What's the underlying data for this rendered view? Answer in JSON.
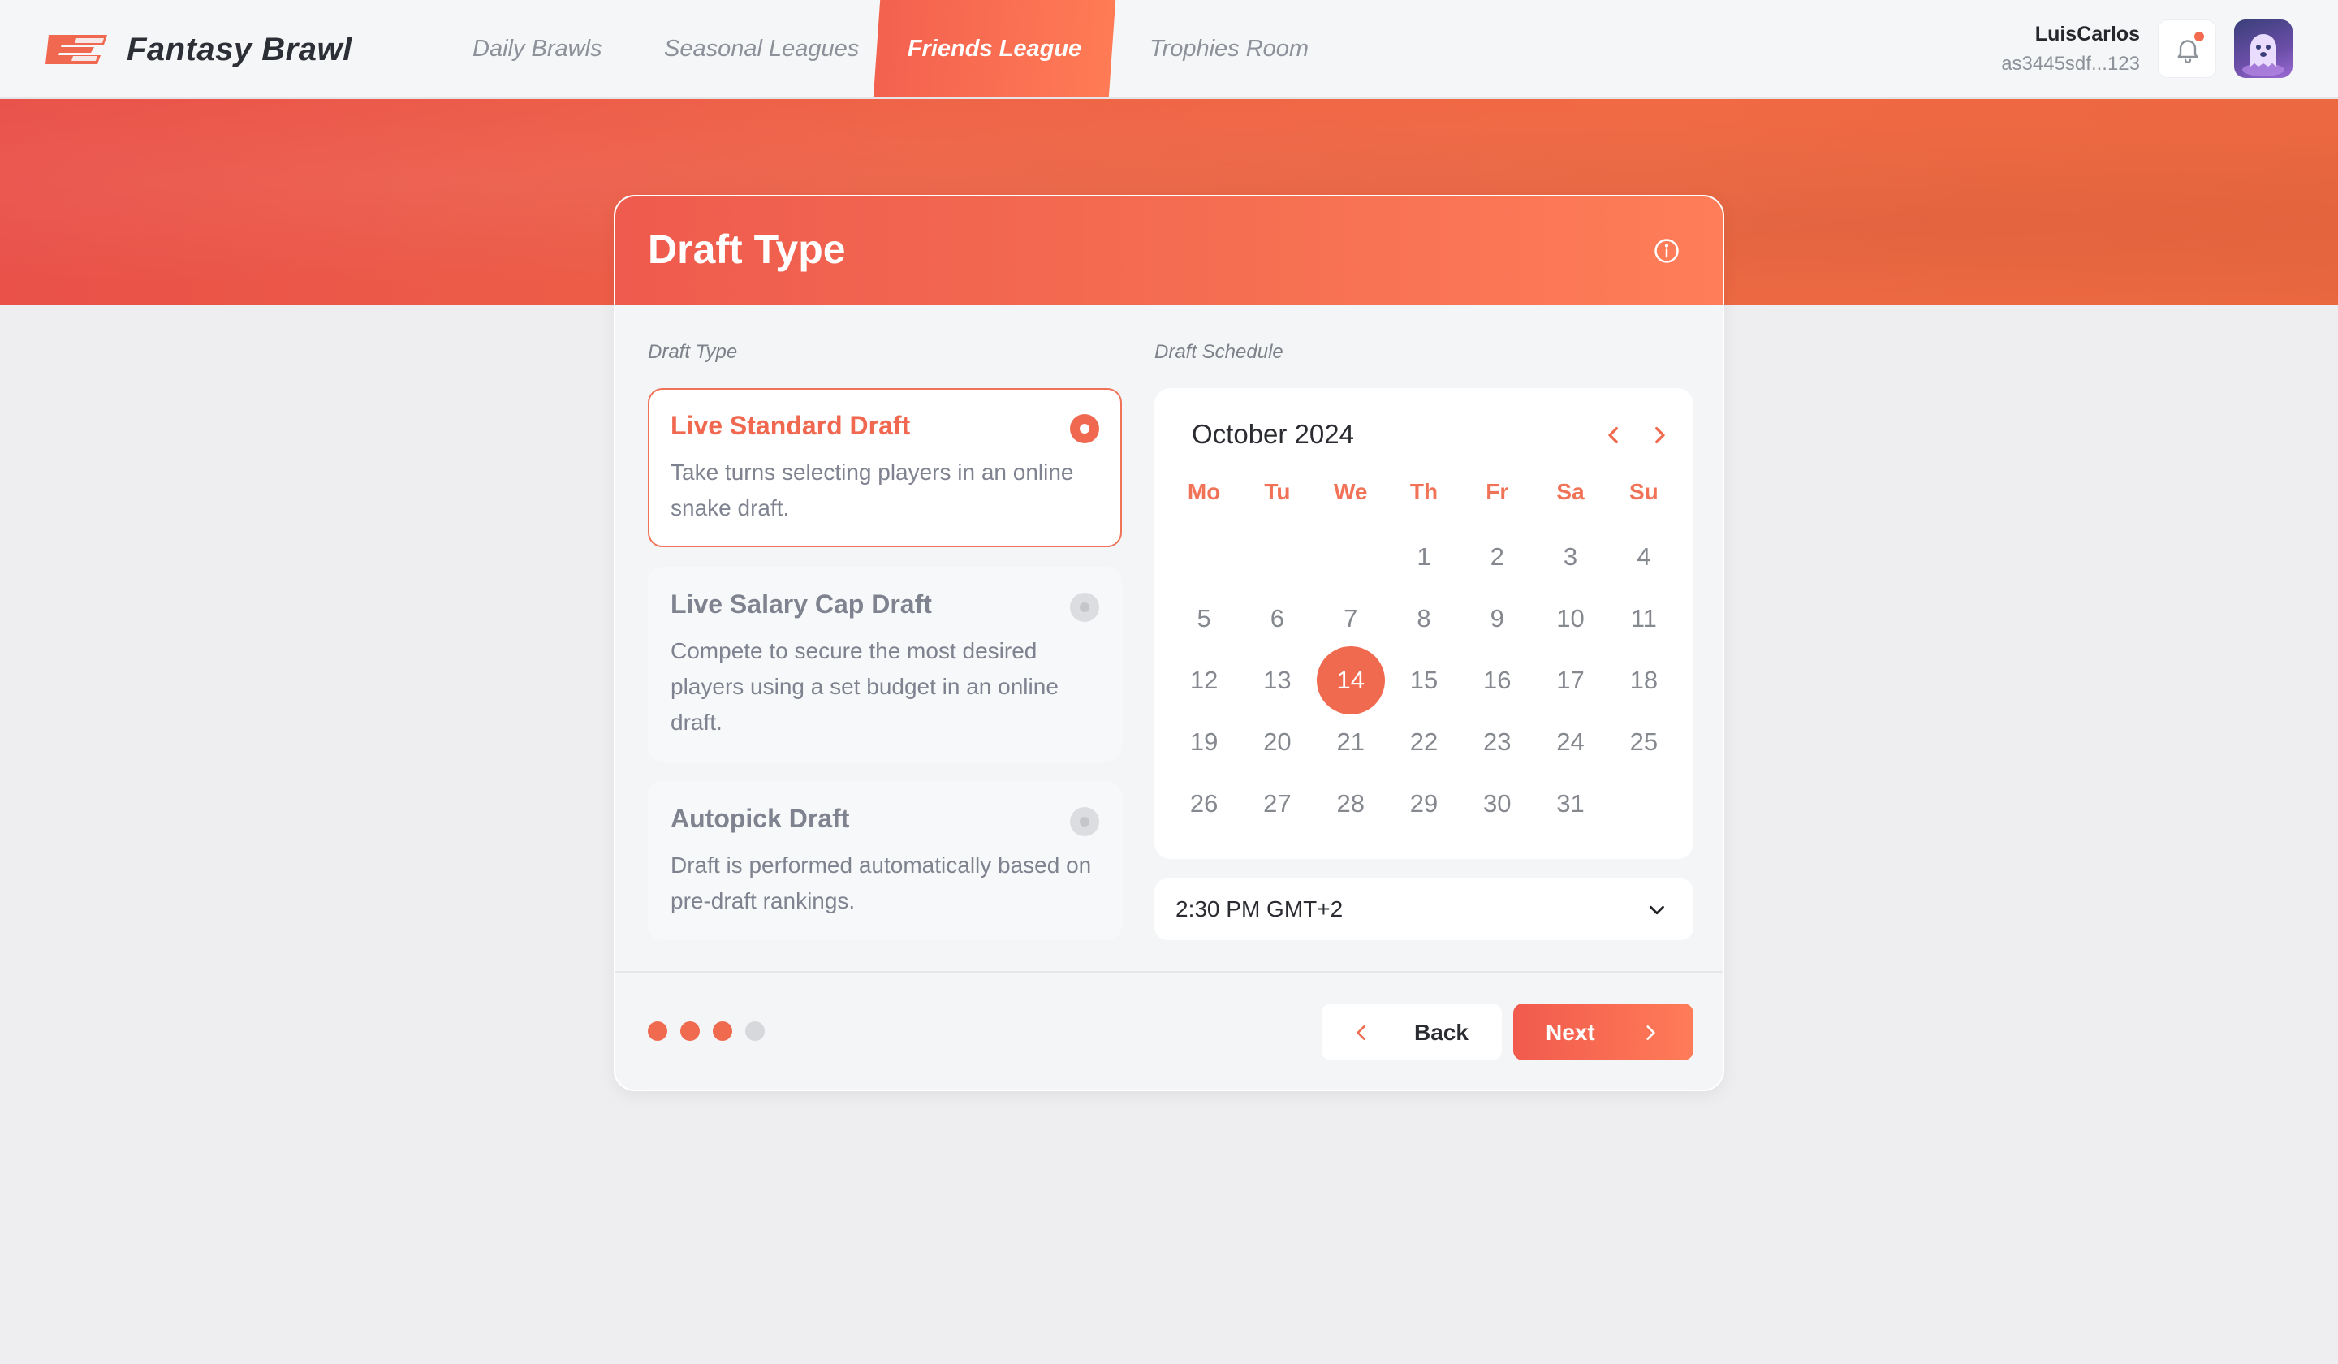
{
  "app": {
    "name": "Fantasy Brawl",
    "logo_icon": "fb-logo-icon"
  },
  "nav": {
    "tabs": [
      {
        "label": "Daily Brawls",
        "active": false
      },
      {
        "label": "Seasonal Leagues",
        "active": false
      },
      {
        "label": "Friends League",
        "active": true
      },
      {
        "label": "Trophies Room",
        "active": false
      }
    ]
  },
  "user": {
    "name": "LuisCarlos",
    "wallet": "as3445sdf...123",
    "has_notification": true
  },
  "card": {
    "title": "Draft Type",
    "draft_type_label": "Draft Type",
    "schedule_label": "Draft Schedule",
    "options": [
      {
        "title": "Live Standard Draft",
        "description": "Take turns selecting players in an online snake draft.",
        "selected": true
      },
      {
        "title": "Live Salary Cap Draft",
        "description": "Compete to secure the most desired players using a set budget in an online draft.",
        "selected": false
      },
      {
        "title": "Autopick Draft",
        "description": "Draft is performed automatically based on pre-draft rankings.",
        "selected": false
      }
    ]
  },
  "calendar": {
    "month_label": "October 2024",
    "weekdays": [
      "Mo",
      "Tu",
      "We",
      "Th",
      "Fr",
      "Sa",
      "Su"
    ],
    "weeks": [
      [
        "",
        "",
        "",
        "1",
        "2",
        "3",
        "4"
      ],
      [
        "5",
        "6",
        "7",
        "8",
        "9",
        "10",
        "11"
      ],
      [
        "12",
        "13",
        "14",
        "15",
        "16",
        "17",
        "18"
      ],
      [
        "19",
        "20",
        "21",
        "22",
        "23",
        "24",
        "25"
      ],
      [
        "26",
        "27",
        "28",
        "29",
        "30",
        "31",
        ""
      ]
    ],
    "selected_day": "14"
  },
  "time": {
    "value": "2:30 PM GMT+2"
  },
  "steps": {
    "total": 4,
    "completed": 3
  },
  "buttons": {
    "back": "Back",
    "next": "Next"
  },
  "colors": {
    "accent": "#f06a4f",
    "accent_light": "#ff7d58",
    "text_muted": "#7f8390"
  }
}
